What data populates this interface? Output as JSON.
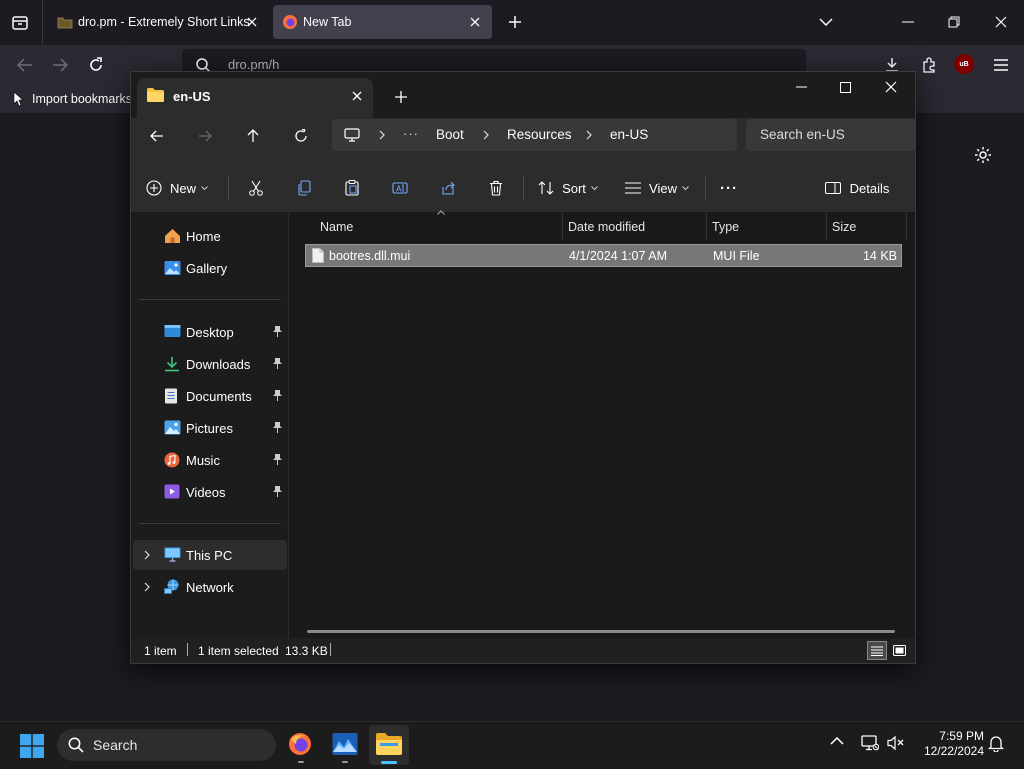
{
  "browser": {
    "tabs": [
      {
        "title": "dro.pm - Extremely Short Links",
        "active": false
      },
      {
        "title": "New Tab",
        "active": true
      }
    ],
    "url": "dro.pm/h",
    "bookmark_import": "Import bookmarks...",
    "ublock_badge": "uB"
  },
  "explorer": {
    "tab_title": "en-US",
    "breadcrumb": [
      "Boot",
      "Resources",
      "en-US"
    ],
    "breadcrumb_more": "···",
    "search_placeholder": "Search en-US",
    "toolbar": {
      "new": "New",
      "sort": "Sort",
      "view": "View",
      "more": "···",
      "details": "Details"
    },
    "nav": {
      "quick": [
        {
          "label": "Home"
        },
        {
          "label": "Gallery"
        }
      ],
      "pinned": [
        {
          "label": "Desktop"
        },
        {
          "label": "Downloads"
        },
        {
          "label": "Documents"
        },
        {
          "label": "Pictures"
        },
        {
          "label": "Music"
        },
        {
          "label": "Videos"
        }
      ],
      "devices": [
        {
          "label": "This PC",
          "selected": true
        },
        {
          "label": "Network"
        }
      ]
    },
    "columns": [
      "Name",
      "Date modified",
      "Type",
      "Size"
    ],
    "files": [
      {
        "name": "bootres.dll.mui",
        "date": "4/1/2024 1:07 AM",
        "type": "MUI File",
        "size": "14 KB",
        "selected": true
      }
    ],
    "status": {
      "count": "1 item",
      "selection": "1 item selected",
      "size": "13.3 KB"
    }
  },
  "taskbar": {
    "search_label": "Search",
    "time": "7:59 PM",
    "date": "12/22/2024"
  },
  "colors": {
    "accent": "#0078d4",
    "folder": "#f5c343",
    "selection": "#777777"
  }
}
